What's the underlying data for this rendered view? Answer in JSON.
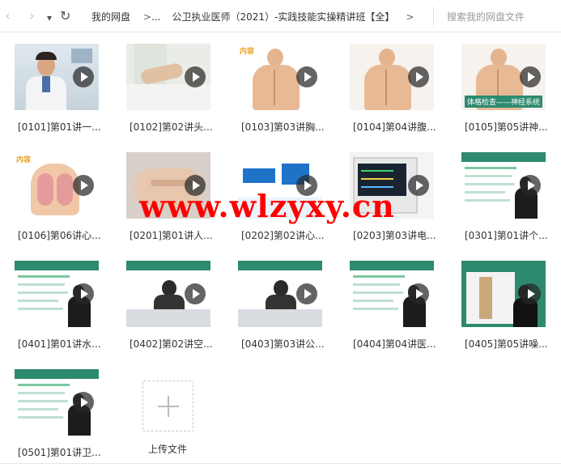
{
  "nav": {
    "back_icon": "‹",
    "forward_icon": "›",
    "dropdown_icon": "▾",
    "refresh_icon": "↻"
  },
  "breadcrumb": {
    "root": "我的网盘",
    "sep1": ">",
    "ellipsis": "...",
    "current": "公卫执业医师（2021）-实践技能实操精讲班【全】",
    "sep2": ">"
  },
  "search": {
    "placeholder": "搜索我的网盘文件"
  },
  "files": [
    {
      "label": "[0101]第01讲一...",
      "thumb": "doctor-lecture"
    },
    {
      "label": "[0102]第02讲头...",
      "thumb": "hand-exam"
    },
    {
      "label": "[0103]第03讲胸...",
      "thumb": "anatomy-chest"
    },
    {
      "label": "[0104]第04讲腹...",
      "thumb": "anatomy-abdomen"
    },
    {
      "label": "[0105]第05讲神...",
      "thumb": "anatomy-back",
      "caption": "体格检查——神经系统"
    },
    {
      "label": "[0106]第06讲心...",
      "thumb": "anatomy-lungs"
    },
    {
      "label": "[0201]第01讲人...",
      "thumb": "hand-closeup"
    },
    {
      "label": "[0202]第02讲心...",
      "thumb": "slide-blue"
    },
    {
      "label": "[0203]第03讲电...",
      "thumb": "monitor-device"
    },
    {
      "label": "[0301]第01讲个...",
      "thumb": "teacher-slide"
    },
    {
      "label": "[0401]第01讲水...",
      "thumb": "teacher-slide"
    },
    {
      "label": "[0402]第02讲空...",
      "thumb": "teacher-demo"
    },
    {
      "label": "[0403]第03讲公...",
      "thumb": "teacher-demo"
    },
    {
      "label": "[0404]第04讲医...",
      "thumb": "teacher-slide"
    },
    {
      "label": "[0405]第05讲噪...",
      "thumb": "teacher-device"
    },
    {
      "label": "[0501]第01讲卫...",
      "thumb": "teacher-slide"
    }
  ],
  "upload": {
    "label": "上传文件"
  },
  "watermark": "www.wlzyxy.cn",
  "colors": {
    "slide_green": "#2d8a6e",
    "accent_orange": "#f0a020",
    "watermark_red": "#ff0000"
  }
}
